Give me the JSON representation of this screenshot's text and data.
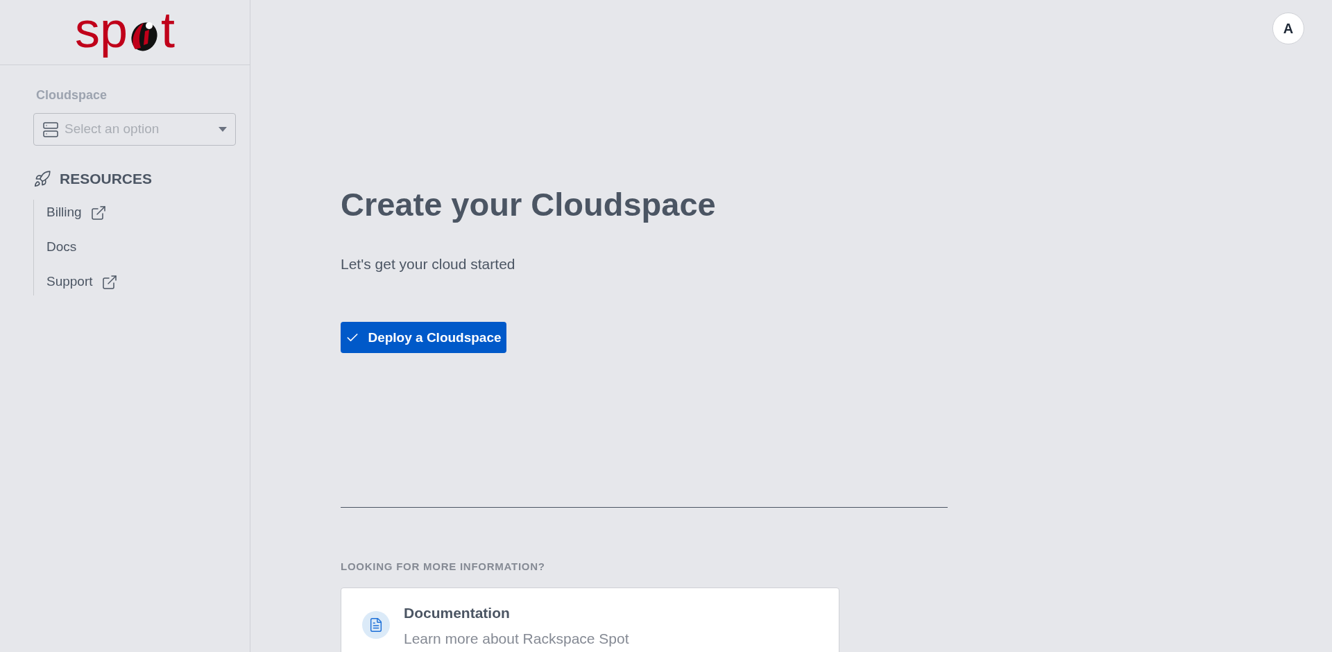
{
  "logo": {
    "left": "sp",
    "right": "t"
  },
  "sidebar": {
    "select_label": "Cloudspace",
    "select": {
      "placeholder": "Select an option"
    },
    "section_title": "RESOURCES",
    "items": [
      {
        "label": "Billing",
        "external": true
      },
      {
        "label": "Docs",
        "external": false
      },
      {
        "label": "Support",
        "external": true
      }
    ]
  },
  "avatar": "A",
  "main": {
    "title": "Create your Cloudspace",
    "subtitle": "Let's get your cloud started",
    "button": "Deploy a Cloudspace",
    "info_heading": "LOOKING FOR MORE INFORMATION?",
    "cards": [
      {
        "title": "Documentation",
        "description": "Learn more about Rackspace Spot"
      }
    ]
  }
}
